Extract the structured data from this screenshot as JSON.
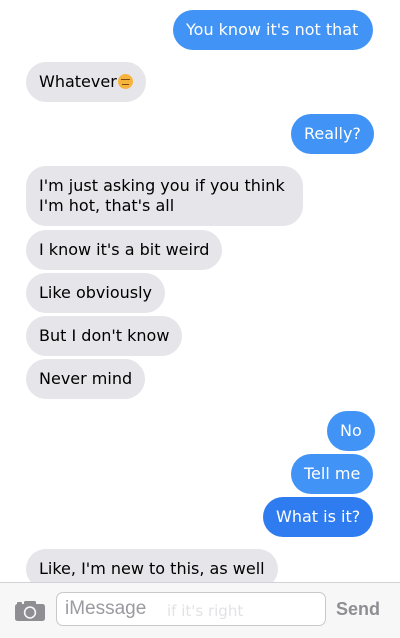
{
  "messages": [
    {
      "text": "You know it's not that",
      "side": "out"
    },
    {
      "text": "Whatever",
      "side": "in",
      "emoji": "expressionless-face-emoji"
    },
    {
      "text": "Really?",
      "side": "out"
    },
    {
      "text": "I'm just asking you if you think I'm hot, that's all",
      "side": "in"
    },
    {
      "text": "I know it's a bit weird",
      "side": "in"
    },
    {
      "text": "Like obviously",
      "side": "in"
    },
    {
      "text": "But I don't know",
      "side": "in"
    },
    {
      "text": "Never mind",
      "side": "in"
    },
    {
      "text": "No",
      "side": "out"
    },
    {
      "text": "Tell me",
      "side": "out"
    },
    {
      "text": "What is it?",
      "side": "out"
    },
    {
      "text": "Like, I'm new to this, as well",
      "side": "in"
    }
  ],
  "composer": {
    "placeholder": "iMessage",
    "partial_text": "if it's right",
    "send_label": "Send",
    "camera_icon": "camera-icon"
  },
  "colors": {
    "incoming_bubble": "#e5e5ea",
    "outgoing_bubble": "#4194f5",
    "send_disabled": "#8e8e93"
  }
}
